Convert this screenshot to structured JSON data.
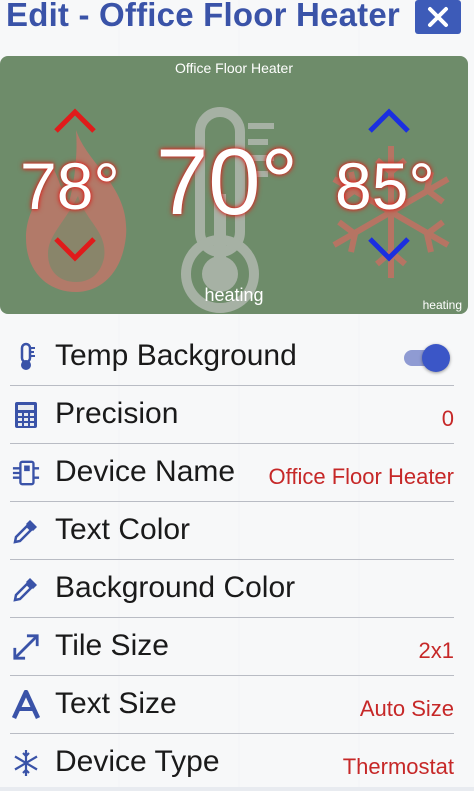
{
  "header": {
    "title": "Edit - Office Floor Heater"
  },
  "tile": {
    "name": "Office Floor Heater",
    "heat_setpoint": "78°",
    "current_temp": "70°",
    "cool_setpoint": "85°",
    "status": "heating",
    "status_small": "heating"
  },
  "settings": [
    {
      "label": "Temp Background",
      "value": "",
      "icon": "thermometer-icon",
      "control": "toggle",
      "toggle_on": true
    },
    {
      "label": "Precision",
      "value": "0",
      "icon": "calculator-icon"
    },
    {
      "label": "Device Name",
      "value": "Office Floor Heater",
      "icon": "device-icon"
    },
    {
      "label": "Text Color",
      "value": "",
      "icon": "eyedropper-icon"
    },
    {
      "label": "Background Color",
      "value": "",
      "icon": "eyedropper-icon"
    },
    {
      "label": "Tile Size",
      "value": "2x1",
      "icon": "resize-arrows-icon"
    },
    {
      "label": "Text Size",
      "value": "Auto Size",
      "icon": "text-size-icon"
    },
    {
      "label": "Device Type",
      "value": "Thermostat",
      "icon": "snowflake-icon"
    }
  ],
  "colors": {
    "accent": "#3a53a8",
    "value": "#c62828",
    "tile_bg": "#6e8c6a"
  }
}
